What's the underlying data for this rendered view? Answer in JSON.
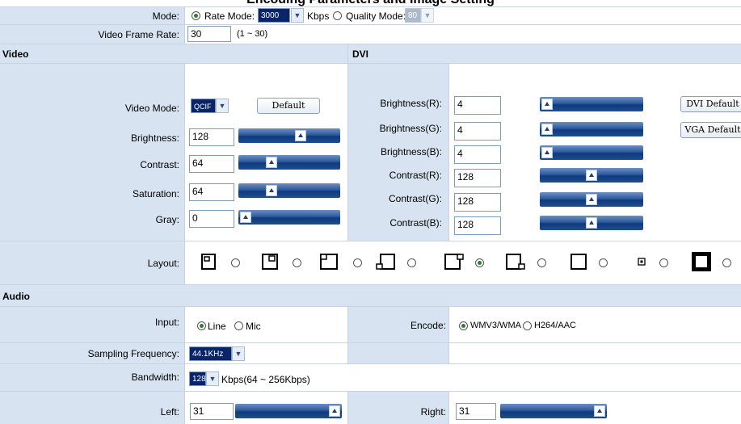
{
  "header": {
    "cut_title": "Encoding Parameters and Image Setting"
  },
  "mode": {
    "label": "Mode:",
    "rate_label": "Rate Mode:",
    "rate_value": "3000",
    "rate_unit": "Kbps",
    "quality_label": "Quality Mode:",
    "quality_value": "80",
    "selected": "rate"
  },
  "frame_rate": {
    "label": "Video Frame Rate:",
    "value": "30",
    "hint": "(1 ~ 30)"
  },
  "video": {
    "title": "Video",
    "mode_label": "Video Mode:",
    "mode_value": "QCIF",
    "default_button": "Default",
    "brightness": {
      "label": "Brightness:",
      "value": "128",
      "level": 0.63
    },
    "contrast": {
      "label": "Contrast:",
      "value": "64",
      "level": 0.3
    },
    "saturation": {
      "label": "Saturation:",
      "value": "64",
      "level": 0.3
    },
    "gray": {
      "label": "Gray:",
      "value": "0",
      "level": 0.0
    }
  },
  "dvi": {
    "title": "DVI",
    "brightness_r": {
      "label": "Brightness(R):",
      "value": "4",
      "level": 0.0
    },
    "brightness_g": {
      "label": "Brightness(G):",
      "value": "4",
      "level": 0.0
    },
    "brightness_b": {
      "label": "Brightness(B):",
      "value": "4",
      "level": 0.0
    },
    "contrast_r": {
      "label": "Contrast(R):",
      "value": "128",
      "level": 0.5
    },
    "contrast_g": {
      "label": "Contrast(G):",
      "value": "128",
      "level": 0.5
    },
    "contrast_b": {
      "label": "Contrast(B):",
      "value": "128",
      "level": 0.5
    },
    "dvi_default_button": "DVI Default",
    "vga_default_button": "VGA Default"
  },
  "layout": {
    "label": "Layout:",
    "selected_index": 4,
    "options": [
      "layout-1",
      "layout-2",
      "layout-3",
      "layout-4",
      "layout-5",
      "layout-6",
      "layout-7",
      "layout-8",
      "layout-9"
    ]
  },
  "audio": {
    "title": "Audio",
    "input_label": "Input:",
    "line_label": "Line",
    "mic_label": "Mic",
    "input_selected": "line",
    "encode_label": "Encode:",
    "wmv_label": "WMV3/WMA",
    "h264_label": "H264/AAC",
    "encode_selected": "wmv",
    "sampling_label": "Sampling Frequency:",
    "sampling_value": "44.1KHz",
    "bandwidth_label": "Bandwidth:",
    "bandwidth_value": "128",
    "bandwidth_hint": "Kbps(64 ~ 256Kbps)",
    "left": {
      "label": "Left:",
      "value": "31",
      "level": 1.0
    },
    "right": {
      "label": "Right:",
      "value": "31",
      "level": 1.0
    }
  },
  "colors": {
    "label_bg": "#d7e3f1",
    "border": "#c8d3df",
    "slider": "#1e4d91",
    "select_bg": "#0a246a"
  }
}
